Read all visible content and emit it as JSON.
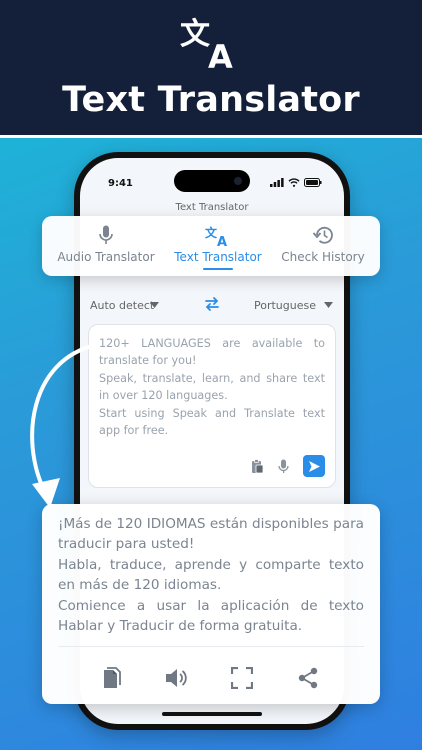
{
  "header": {
    "title": "Text Translator",
    "logo_icon": "translate-icon",
    "background": "#14203a"
  },
  "phone": {
    "status_time": "9:41",
    "app_title": "Text Translator"
  },
  "tabs": [
    {
      "label": "Audio Translator",
      "icon": "microphone-icon",
      "active": false
    },
    {
      "label": "Text Translator",
      "icon": "translate-icon",
      "active": true
    },
    {
      "label": "Check History",
      "icon": "history-icon",
      "active": false
    }
  ],
  "languages": {
    "source": "Auto detect",
    "target": "Portuguese",
    "swap_icon": "swap-icon"
  },
  "input": {
    "lines": [
      "120+ LANGUAGES are available to translate for you!",
      "Speak, translate, learn, and share text in over 120 languages.",
      "Start using Speak and Translate text app for free."
    ]
  },
  "output": {
    "lines": [
      "¡Más de 120 IDIOMAS están disponibles para traducir para usted!",
      "Habla, traduce, aprende y comparte texto en más de 120 idiomas.",
      "Comience a usar la aplicación de texto Hablar y Traducir de forma gratuita."
    ],
    "tools": [
      "copy-icon",
      "speaker-icon",
      "fullscreen-icon",
      "share-icon"
    ]
  },
  "colors": {
    "accent": "#2a8de8",
    "gradient_start": "#18bfd6",
    "gradient_end": "#2f7fe0"
  }
}
